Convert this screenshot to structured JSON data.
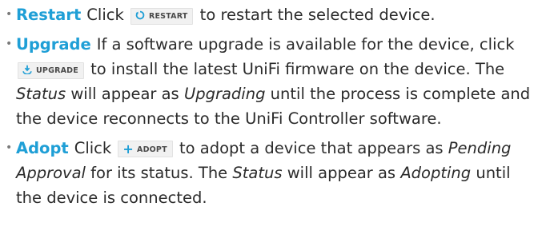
{
  "items": [
    {
      "term": "Restart",
      "pre": "Click",
      "button": {
        "label": "RESTART",
        "icon": "restart-icon"
      },
      "post": "to restart the selected device."
    },
    {
      "term": "Upgrade",
      "pre": "If a software upgrade is available for the device, click",
      "button": {
        "label": "UPGRADE",
        "icon": "upgrade-icon"
      },
      "post_a": "to install the latest UniFi firmware on the device. The",
      "em1": "Status",
      "post_b": "will appear as",
      "em2": "Upgrading",
      "post_c": "until the process is complete and the device reconnects to the UniFi Controller software."
    },
    {
      "term": "Adopt",
      "pre": "Click",
      "button": {
        "label": "ADOPT",
        "icon": "plus-icon"
      },
      "post_a": "to adopt a device that appears as",
      "em1": "Pending Approval",
      "post_b": "for its status. The",
      "em2": "Status",
      "post_c": "will appear as",
      "em3": "Adopting",
      "post_d": "until the device is connected."
    }
  ],
  "colors": {
    "term": "#1f9fd6",
    "text": "#2b2b2b",
    "button_bg": "#f1f1f1",
    "bullet": "#7a7a7a"
  }
}
